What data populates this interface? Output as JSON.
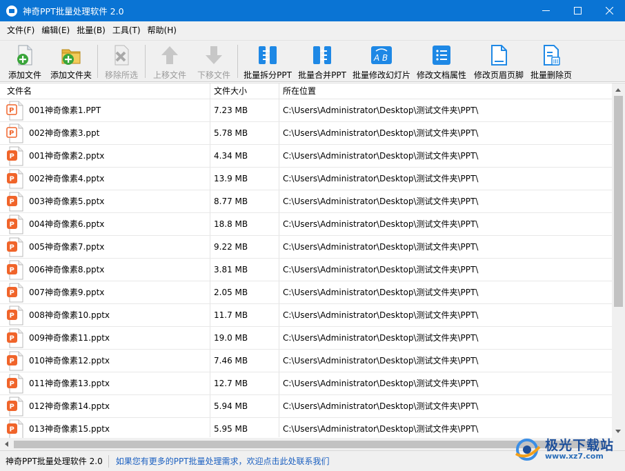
{
  "window": {
    "title": "神奇PPT批量处理软件 2.0"
  },
  "menu": [
    {
      "label": "文件(F)"
    },
    {
      "label": "编辑(E)"
    },
    {
      "label": "批量(B)"
    },
    {
      "label": "工具(T)"
    },
    {
      "label": "帮助(H)"
    }
  ],
  "toolbar": {
    "add_file": "添加文件",
    "add_folder": "添加文件夹",
    "remove_selected": "移除所选",
    "move_up": "上移文件",
    "move_down": "下移文件",
    "split_ppt": "批量拆分PPT",
    "merge_ppt": "批量合并PPT",
    "modify_slides": "批量修改幻灯片",
    "modify_props": "修改文档属性",
    "modify_header_footer": "修改页眉页脚",
    "delete_pages": "批量删除页"
  },
  "table": {
    "columns": [
      "文件名",
      "文件大小",
      "所在位置"
    ],
    "rows": [
      {
        "name": "001神奇像素1.PPT",
        "size": "7.23 MB",
        "path": "C:\\Users\\Administrator\\Desktop\\测试文件夹\\PPT\\",
        "type": "ppt"
      },
      {
        "name": "002神奇像素3.ppt",
        "size": "5.78 MB",
        "path": "C:\\Users\\Administrator\\Desktop\\测试文件夹\\PPT\\",
        "type": "ppt"
      },
      {
        "name": "001神奇像素2.pptx",
        "size": "4.34 MB",
        "path": "C:\\Users\\Administrator\\Desktop\\测试文件夹\\PPT\\",
        "type": "pptx"
      },
      {
        "name": "002神奇像素4.pptx",
        "size": "13.9 MB",
        "path": "C:\\Users\\Administrator\\Desktop\\测试文件夹\\PPT\\",
        "type": "pptx"
      },
      {
        "name": "003神奇像素5.pptx",
        "size": "8.77 MB",
        "path": "C:\\Users\\Administrator\\Desktop\\测试文件夹\\PPT\\",
        "type": "pptx"
      },
      {
        "name": "004神奇像素6.pptx",
        "size": "18.8 MB",
        "path": "C:\\Users\\Administrator\\Desktop\\测试文件夹\\PPT\\",
        "type": "pptx"
      },
      {
        "name": "005神奇像素7.pptx",
        "size": "9.22 MB",
        "path": "C:\\Users\\Administrator\\Desktop\\测试文件夹\\PPT\\",
        "type": "pptx"
      },
      {
        "name": "006神奇像素8.pptx",
        "size": "3.81 MB",
        "path": "C:\\Users\\Administrator\\Desktop\\测试文件夹\\PPT\\",
        "type": "pptx"
      },
      {
        "name": "007神奇像素9.pptx",
        "size": "2.05 MB",
        "path": "C:\\Users\\Administrator\\Desktop\\测试文件夹\\PPT\\",
        "type": "pptx"
      },
      {
        "name": "008神奇像素10.pptx",
        "size": "11.7 MB",
        "path": "C:\\Users\\Administrator\\Desktop\\测试文件夹\\PPT\\",
        "type": "pptx"
      },
      {
        "name": "009神奇像素11.pptx",
        "size": "19.0 MB",
        "path": "C:\\Users\\Administrator\\Desktop\\测试文件夹\\PPT\\",
        "type": "pptx"
      },
      {
        "name": "010神奇像素12.pptx",
        "size": "7.46 MB",
        "path": "C:\\Users\\Administrator\\Desktop\\测试文件夹\\PPT\\",
        "type": "pptx"
      },
      {
        "name": "011神奇像素13.pptx",
        "size": "12.7 MB",
        "path": "C:\\Users\\Administrator\\Desktop\\测试文件夹\\PPT\\",
        "type": "pptx"
      },
      {
        "name": "012神奇像素14.pptx",
        "size": "5.94 MB",
        "path": "C:\\Users\\Administrator\\Desktop\\测试文件夹\\PPT\\",
        "type": "pptx"
      },
      {
        "name": "013神奇像素15.pptx",
        "size": "5.95 MB",
        "path": "C:\\Users\\Administrator\\Desktop\\测试文件夹\\PPT\\",
        "type": "pptx"
      }
    ]
  },
  "status": {
    "app_name": "神奇PPT批量处理软件 2.0",
    "link_text": "如果您有更多的PPT批量处理需求，欢迎点击此处联系我们"
  },
  "watermark": {
    "main": "极光下载站",
    "sub": "www.xz7.com"
  },
  "colors": {
    "titlebar": "#0a74d4",
    "accent_blue": "#1e88e5",
    "ppt_orange": "#f0642a",
    "link": "#1a5fc0"
  },
  "icons": {
    "app": "app-logo-icon",
    "add_file": "add-file-icon",
    "add_folder": "add-folder-icon",
    "remove": "remove-icon",
    "up": "arrow-up-icon",
    "down": "arrow-down-icon",
    "split": "split-icon",
    "merge": "merge-icon",
    "slides": "ab-slides-icon",
    "props": "properties-icon",
    "header_footer": "header-footer-icon",
    "delete_pages": "delete-pages-icon",
    "ppt_file": "ppt-file-icon"
  }
}
